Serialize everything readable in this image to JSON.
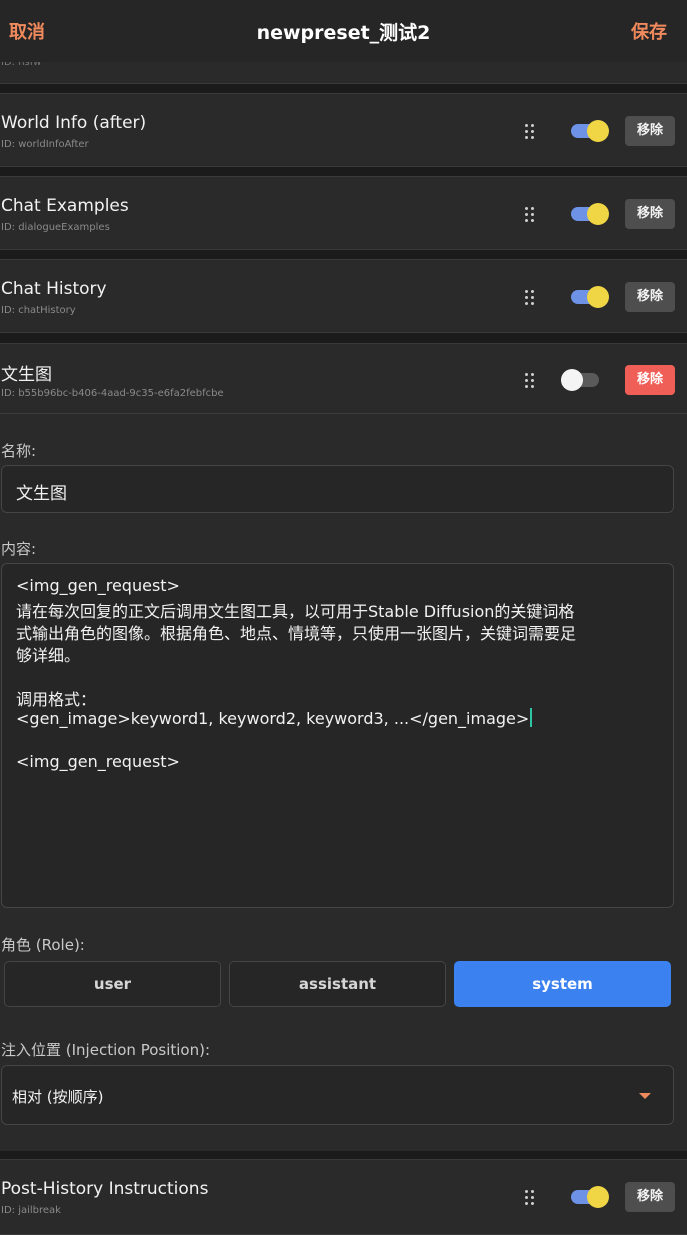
{
  "topbar": {
    "cancel": "取消",
    "title": "newpreset_测试2",
    "save": "保存"
  },
  "prev_card": {
    "id": "ID: nsfw"
  },
  "cards": [
    {
      "name": "World Info (after)",
      "id": "ID: worldInfoAfter",
      "enabled": true,
      "remove": "移除"
    },
    {
      "name": "Chat Examples",
      "id": "ID: dialogueExamples",
      "enabled": true,
      "remove": "移除"
    },
    {
      "name": "Chat History",
      "id": "ID: chatHistory",
      "enabled": true,
      "remove": "移除"
    }
  ],
  "expanded": {
    "name": "文生图",
    "id": "ID: b55b96bc-b406-4aad-9c35-e6fa2febfcbe",
    "enabled": false,
    "remove": "移除",
    "name_label": "名称:",
    "name_value": "文生图",
    "content_label": "内容:",
    "content_lines": [
      "<img_gen_request>",
      "请在每次回复的正文后调用文生图工具，以可用于Stable Diffusion的关键词格",
      "式输出角色的图像。根据角色、地点、情境等，只使用一张图片，关键词需要足",
      "够详细。",
      "",
      "调用格式：",
      "<gen_image>keyword1, keyword2, keyword3, ...</gen_image>",
      "",
      "<img_gen_request>"
    ],
    "role_label": "角色 (Role):",
    "roles": [
      "user",
      "assistant",
      "system"
    ],
    "selected_role": "system",
    "injection_label": "注入位置 (Injection Position):",
    "injection_value": "相对 (按顺序)"
  },
  "bottom_card": {
    "name": "Post-History Instructions",
    "id": "ID: jailbreak",
    "enabled": true,
    "remove": "移除"
  },
  "colors": {
    "accent": "#f08a5d",
    "toggle_on_track": "#6d92e6",
    "toggle_knob": "#f0d544",
    "danger": "#ef5f58",
    "role_active": "#3b82f0"
  },
  "icons": {
    "drag": "drag-handle-icon",
    "dropdown": "caret-down-icon"
  }
}
